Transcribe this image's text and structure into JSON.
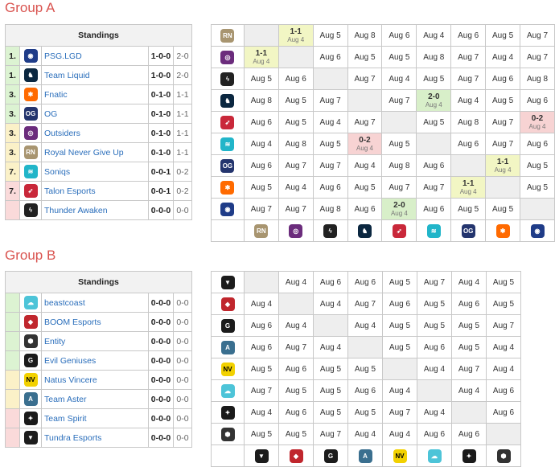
{
  "groups": [
    {
      "title": "Group A",
      "standings_header": "Standings",
      "standings": [
        {
          "rank": "1.",
          "name": "PSG.LGD",
          "record": "1-0-0",
          "games": "2-0",
          "tier": "adv",
          "icon": "psg-lgd-logo-icon"
        },
        {
          "rank": "1.",
          "name": "Team Liquid",
          "record": "1-0-0",
          "games": "2-0",
          "tier": "adv",
          "icon": "team-liquid-logo-icon"
        },
        {
          "rank": "3.",
          "name": "Fnatic",
          "record": "0-1-0",
          "games": "1-1",
          "tier": "adv",
          "icon": "fnatic-logo-icon"
        },
        {
          "rank": "3.",
          "name": "OG",
          "record": "0-1-0",
          "games": "1-1",
          "tier": "adv",
          "icon": "og-logo-icon"
        },
        {
          "rank": "3.",
          "name": "Outsiders",
          "record": "0-1-0",
          "games": "1-1",
          "tier": "mid",
          "icon": "outsiders-logo-icon"
        },
        {
          "rank": "3.",
          "name": "Royal Never Give Up",
          "record": "0-1-0",
          "games": "1-1",
          "tier": "mid",
          "icon": "rng-logo-icon"
        },
        {
          "rank": "7.",
          "name": "Soniqs",
          "record": "0-0-1",
          "games": "0-2",
          "tier": "mid",
          "icon": "soniqs-logo-icon"
        },
        {
          "rank": "7.",
          "name": "Talon Esports",
          "record": "0-0-1",
          "games": "0-2",
          "tier": "elim",
          "icon": "talon-logo-icon"
        },
        {
          "rank": "",
          "name": "Thunder Awaken",
          "record": "0-0-0",
          "games": "0-0",
          "tier": "elim",
          "icon": "thunder-awaken-logo-icon"
        }
      ],
      "crosstable": {
        "col_icons": [
          "rng-logo-icon",
          "outsiders-logo-icon",
          "thunder-awaken-logo-icon",
          "team-liquid-logo-icon",
          "talon-logo-icon",
          "soniqs-logo-icon",
          "og-logo-icon",
          "fnatic-logo-icon",
          "psg-lgd-logo-icon"
        ],
        "rows": [
          {
            "icon": "rng-logo-icon",
            "cells": [
              {
                "t": "na"
              },
              {
                "t": "win",
                "score": "1-1",
                "date": "Aug 4"
              },
              {
                "text": "Aug 5"
              },
              {
                "text": "Aug 8"
              },
              {
                "text": "Aug 6"
              },
              {
                "text": "Aug 4"
              },
              {
                "text": "Aug 6"
              },
              {
                "text": "Aug 5"
              },
              {
                "text": "Aug 7"
              }
            ]
          },
          {
            "icon": "outsiders-logo-icon",
            "cells": [
              {
                "t": "win",
                "score": "1-1",
                "date": "Aug 4"
              },
              {
                "t": "na"
              },
              {
                "text": "Aug 6"
              },
              {
                "text": "Aug 5"
              },
              {
                "text": "Aug 5"
              },
              {
                "text": "Aug 8"
              },
              {
                "text": "Aug 7"
              },
              {
                "text": "Aug 4"
              },
              {
                "text": "Aug 7"
              }
            ]
          },
          {
            "icon": "thunder-awaken-logo-icon",
            "cells": [
              {
                "text": "Aug 5"
              },
              {
                "text": "Aug 6"
              },
              {
                "t": "na"
              },
              {
                "text": "Aug 7"
              },
              {
                "text": "Aug 4"
              },
              {
                "text": "Aug 5"
              },
              {
                "text": "Aug 7"
              },
              {
                "text": "Aug 6"
              },
              {
                "text": "Aug 8"
              }
            ]
          },
          {
            "icon": "team-liquid-logo-icon",
            "cells": [
              {
                "text": "Aug 8"
              },
              {
                "text": "Aug 5"
              },
              {
                "text": "Aug 7"
              },
              {
                "t": "na"
              },
              {
                "text": "Aug 7"
              },
              {
                "t": "won",
                "score": "2-0",
                "date": "Aug 4"
              },
              {
                "text": "Aug 4"
              },
              {
                "text": "Aug 5"
              },
              {
                "text": "Aug 6"
              }
            ]
          },
          {
            "icon": "talon-logo-icon",
            "cells": [
              {
                "text": "Aug 6"
              },
              {
                "text": "Aug 5"
              },
              {
                "text": "Aug 4"
              },
              {
                "text": "Aug 7"
              },
              {
                "t": "na"
              },
              {
                "text": "Aug 5"
              },
              {
                "text": "Aug 8"
              },
              {
                "text": "Aug 7"
              },
              {
                "t": "loss",
                "score": "0-2",
                "date": "Aug 4"
              }
            ]
          },
          {
            "icon": "soniqs-logo-icon",
            "cells": [
              {
                "text": "Aug 4"
              },
              {
                "text": "Aug 8"
              },
              {
                "text": "Aug 5"
              },
              {
                "t": "loss",
                "score": "0-2",
                "date": "Aug 4"
              },
              {
                "text": "Aug 5"
              },
              {
                "t": "na"
              },
              {
                "text": "Aug 6"
              },
              {
                "text": "Aug 7"
              },
              {
                "text": "Aug 6"
              }
            ]
          },
          {
            "icon": "og-logo-icon",
            "cells": [
              {
                "text": "Aug 6"
              },
              {
                "text": "Aug 7"
              },
              {
                "text": "Aug 7"
              },
              {
                "text": "Aug 4"
              },
              {
                "text": "Aug 8"
              },
              {
                "text": "Aug 6"
              },
              {
                "t": "na"
              },
              {
                "t": "win",
                "score": "1-1",
                "date": "Aug 4"
              },
              {
                "text": "Aug 5"
              }
            ]
          },
          {
            "icon": "fnatic-logo-icon",
            "cells": [
              {
                "text": "Aug 5"
              },
              {
                "text": "Aug 4"
              },
              {
                "text": "Aug 6"
              },
              {
                "text": "Aug 5"
              },
              {
                "text": "Aug 7"
              },
              {
                "text": "Aug 7"
              },
              {
                "t": "win",
                "score": "1-1",
                "date": "Aug 4"
              },
              {
                "t": "na"
              },
              {
                "text": "Aug 5"
              }
            ]
          },
          {
            "icon": "psg-lgd-logo-icon",
            "cells": [
              {
                "text": "Aug 7"
              },
              {
                "text": "Aug 7"
              },
              {
                "text": "Aug 8"
              },
              {
                "text": "Aug 6"
              },
              {
                "t": "won",
                "score": "2-0",
                "date": "Aug 4"
              },
              {
                "text": "Aug 6"
              },
              {
                "text": "Aug 5"
              },
              {
                "text": "Aug 5"
              },
              {
                "t": "na"
              }
            ]
          }
        ]
      }
    },
    {
      "title": "Group B",
      "standings_header": "Standings",
      "standings": [
        {
          "rank": "",
          "name": "beastcoast",
          "record": "0-0-0",
          "games": "0-0",
          "tier": "adv",
          "icon": "beastcoast-logo-icon"
        },
        {
          "rank": "",
          "name": "BOOM Esports",
          "record": "0-0-0",
          "games": "0-0",
          "tier": "adv",
          "icon": "boom-logo-icon"
        },
        {
          "rank": "",
          "name": "Entity",
          "record": "0-0-0",
          "games": "0-0",
          "tier": "adv",
          "icon": "entity-logo-icon"
        },
        {
          "rank": "",
          "name": "Evil Geniuses",
          "record": "0-0-0",
          "games": "0-0",
          "tier": "adv",
          "icon": "evil-geniuses-logo-icon"
        },
        {
          "rank": "",
          "name": "Natus Vincere",
          "record": "0-0-0",
          "games": "0-0",
          "tier": "mid",
          "icon": "navi-logo-icon"
        },
        {
          "rank": "",
          "name": "Team Aster",
          "record": "0-0-0",
          "games": "0-0",
          "tier": "mid",
          "icon": "team-aster-logo-icon"
        },
        {
          "rank": "",
          "name": "Team Spirit",
          "record": "0-0-0",
          "games": "0-0",
          "tier": "elim",
          "icon": "team-spirit-logo-icon"
        },
        {
          "rank": "",
          "name": "Tundra Esports",
          "record": "0-0-0",
          "games": "0-0",
          "tier": "elim",
          "icon": "tundra-logo-icon"
        }
      ],
      "crosstable": {
        "col_icons": [
          "tundra-logo-icon",
          "boom-logo-icon",
          "evil-geniuses-logo-icon",
          "team-aster-logo-icon",
          "navi-logo-icon",
          "beastcoast-logo-icon",
          "team-spirit-logo-icon",
          "entity-logo-icon"
        ],
        "rows": [
          {
            "icon": "tundra-logo-icon",
            "cells": [
              {
                "t": "na"
              },
              {
                "text": "Aug 4"
              },
              {
                "text": "Aug 6"
              },
              {
                "text": "Aug 6"
              },
              {
                "text": "Aug 5"
              },
              {
                "text": "Aug 7"
              },
              {
                "text": "Aug 4"
              },
              {
                "text": "Aug 5"
              }
            ]
          },
          {
            "icon": "boom-logo-icon",
            "cells": [
              {
                "text": "Aug 4"
              },
              {
                "t": "na"
              },
              {
                "text": "Aug 4"
              },
              {
                "text": "Aug 7"
              },
              {
                "text": "Aug 6"
              },
              {
                "text": "Aug 5"
              },
              {
                "text": "Aug 6"
              },
              {
                "text": "Aug 5"
              }
            ]
          },
          {
            "icon": "evil-geniuses-logo-icon",
            "cells": [
              {
                "text": "Aug 6"
              },
              {
                "text": "Aug 4"
              },
              {
                "t": "na"
              },
              {
                "text": "Aug 4"
              },
              {
                "text": "Aug 5"
              },
              {
                "text": "Aug 5"
              },
              {
                "text": "Aug 5"
              },
              {
                "text": "Aug 7"
              }
            ]
          },
          {
            "icon": "team-aster-logo-icon",
            "cells": [
              {
                "text": "Aug 6"
              },
              {
                "text": "Aug 7"
              },
              {
                "text": "Aug 4"
              },
              {
                "t": "na"
              },
              {
                "text": "Aug 5"
              },
              {
                "text": "Aug 6"
              },
              {
                "text": "Aug 5"
              },
              {
                "text": "Aug 4"
              }
            ]
          },
          {
            "icon": "navi-logo-icon",
            "cells": [
              {
                "text": "Aug 5"
              },
              {
                "text": "Aug 6"
              },
              {
                "text": "Aug 5"
              },
              {
                "text": "Aug 5"
              },
              {
                "t": "na"
              },
              {
                "text": "Aug 4"
              },
              {
                "text": "Aug 7"
              },
              {
                "text": "Aug 4"
              }
            ]
          },
          {
            "icon": "beastcoast-logo-icon",
            "cells": [
              {
                "text": "Aug 7"
              },
              {
                "text": "Aug 5"
              },
              {
                "text": "Aug 5"
              },
              {
                "text": "Aug 6"
              },
              {
                "text": "Aug 4"
              },
              {
                "t": "na"
              },
              {
                "text": "Aug 4"
              },
              {
                "text": "Aug 6"
              }
            ]
          },
          {
            "icon": "team-spirit-logo-icon",
            "cells": [
              {
                "text": "Aug 4"
              },
              {
                "text": "Aug 6"
              },
              {
                "text": "Aug 5"
              },
              {
                "text": "Aug 5"
              },
              {
                "text": "Aug 7"
              },
              {
                "text": "Aug 4"
              },
              {
                "t": "na"
              },
              {
                "text": "Aug 6"
              }
            ]
          },
          {
            "icon": "entity-logo-icon",
            "cells": [
              {
                "text": "Aug 5"
              },
              {
                "text": "Aug 5"
              },
              {
                "text": "Aug 7"
              },
              {
                "text": "Aug 4"
              },
              {
                "text": "Aug 4"
              },
              {
                "text": "Aug 6"
              },
              {
                "text": "Aug 6"
              },
              {
                "t": "na"
              }
            ]
          }
        ]
      }
    }
  ],
  "colors": {
    "title": "#d9534f",
    "link": "#2a6ebb",
    "advance": "#dcf3d2",
    "middle": "#fbf1c8",
    "eliminated": "#fadada",
    "draw": "#f2f6c4",
    "win": "#d8efc9",
    "loss": "#f7d3d3"
  },
  "icons": {
    "psg-lgd-logo-icon": {
      "glyph": "◉",
      "bg": "#1f3c88"
    },
    "team-liquid-logo-icon": {
      "glyph": "♞",
      "bg": "#0b2740"
    },
    "fnatic-logo-icon": {
      "glyph": "✱",
      "bg": "#ff6a00"
    },
    "og-logo-icon": {
      "glyph": "OG",
      "bg": "#24356e"
    },
    "outsiders-logo-icon": {
      "glyph": "◎",
      "bg": "#6b2c7c"
    },
    "rng-logo-icon": {
      "glyph": "RN",
      "bg": "#a89570"
    },
    "soniqs-logo-icon": {
      "glyph": "≋",
      "bg": "#21b5c9"
    },
    "talon-logo-icon": {
      "glyph": "➶",
      "bg": "#c9283a"
    },
    "thunder-awaken-logo-icon": {
      "glyph": "ϟ",
      "bg": "#222222"
    },
    "beastcoast-logo-icon": {
      "glyph": "☁",
      "bg": "#4dc4d8"
    },
    "boom-logo-icon": {
      "glyph": "◆",
      "bg": "#c0262d"
    },
    "entity-logo-icon": {
      "glyph": "⬢",
      "bg": "#333333"
    },
    "evil-geniuses-logo-icon": {
      "glyph": "G",
      "bg": "#1b1b1b"
    },
    "navi-logo-icon": {
      "glyph": "NV",
      "bg": "#f2d100"
    },
    "team-aster-logo-icon": {
      "glyph": "A",
      "bg": "#3a6f8f"
    },
    "team-spirit-logo-icon": {
      "glyph": "✦",
      "bg": "#1a1a1a"
    },
    "tundra-logo-icon": {
      "glyph": "▼",
      "bg": "#1c1c1c"
    }
  }
}
